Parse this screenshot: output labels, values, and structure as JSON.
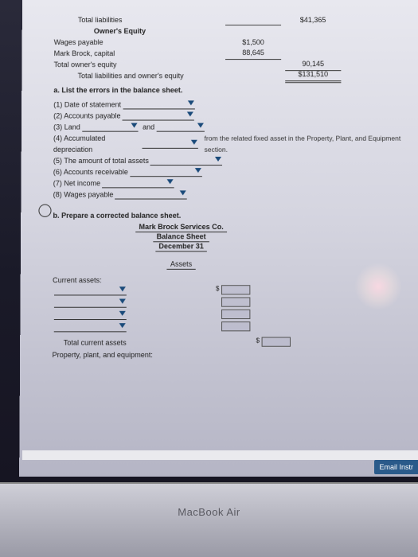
{
  "balance": {
    "total_liab_label": "Total liabilities",
    "total_liab_amt": "$41,365",
    "owners_equity_hdr": "Owner's Equity",
    "wages_payable_label": "Wages payable",
    "wages_payable_amt": "$1,500",
    "mark_brock_label": "Mark Brock, capital",
    "mark_brock_amt": "88,645",
    "total_oe_label": "Total owner's equity",
    "total_oe_amt": "90,145",
    "total_liab_oe_label": "Total liabilities and owner's equity",
    "total_liab_oe_amt": "$131,510"
  },
  "partA": {
    "heading": "a. List the errors in the balance sheet.",
    "items": {
      "i1": "(1) Date of statement",
      "i2": "(2) Accounts payable",
      "i3": "(3) Land",
      "i3_and": "and",
      "i4": "(4) Accumulated depreciation",
      "i4_tail": "from the related fixed asset in the Property, Plant, and Equipment section.",
      "i5": "(5) The amount of total assets",
      "i6": "(6) Accounts receivable",
      "i7": "(7) Net income",
      "i8": "(8) Wages payable"
    }
  },
  "partB": {
    "heading": "b. Prepare a corrected balance sheet.",
    "co": "Mark Brock Services Co.",
    "title": "Balance Sheet",
    "date": "December 31",
    "assets_hdr": "Assets",
    "current_assets": "Current assets:",
    "total_current": "Total current assets",
    "ppe": "Property, plant, and equipment:"
  },
  "ui": {
    "email_btn": "Email Instr",
    "laptop": "MacBook Air"
  }
}
